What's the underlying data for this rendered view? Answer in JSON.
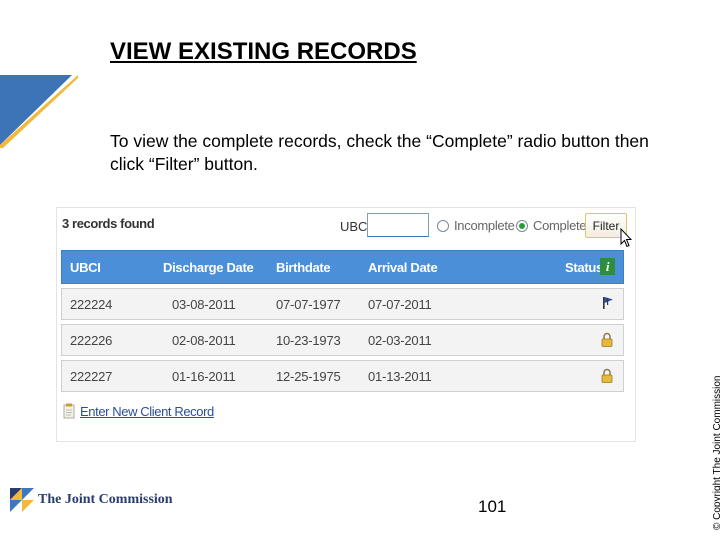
{
  "slide": {
    "title": "VIEW EXISTING RECORDS",
    "instructions": "To view the complete records, check the “Complete” radio button then click “Filter” button.",
    "copyright": "© Copyright The Joint Commission",
    "page_number": "101",
    "logo_text": "The Joint Commission"
  },
  "app": {
    "records_count": "3 records found",
    "filter": {
      "ubci_label": "UBCI",
      "ubci_value": "",
      "options": [
        {
          "label": "Incomplete",
          "checked": false
        },
        {
          "label": "Complete",
          "checked": true
        }
      ],
      "button_label": "Filter"
    },
    "table": {
      "columns": [
        "UBCI",
        "Discharge Date",
        "Birthdate",
        "Arrival Date",
        "Status"
      ],
      "rows": [
        {
          "ubci": "222224",
          "discharge": "03-08-2011",
          "birthdate": "07-07-1977",
          "arrival": "07-07-2011",
          "status_icon": "flag-icon"
        },
        {
          "ubci": "222226",
          "discharge": "02-08-2011",
          "birthdate": "10-23-1973",
          "arrival": "02-03-2011",
          "status_icon": "lock-icon"
        },
        {
          "ubci": "222227",
          "discharge": "01-16-2011",
          "birthdate": "12-25-1975",
          "arrival": "01-13-2011",
          "status_icon": "lock-icon"
        }
      ]
    },
    "enter_new_link": "Enter New Client Record"
  },
  "colors": {
    "header_blue": "#4a8fd7",
    "logo_navy": "#2a3d6e",
    "logo_blue": "#3a78c2",
    "logo_gold": "#f2b93b"
  }
}
